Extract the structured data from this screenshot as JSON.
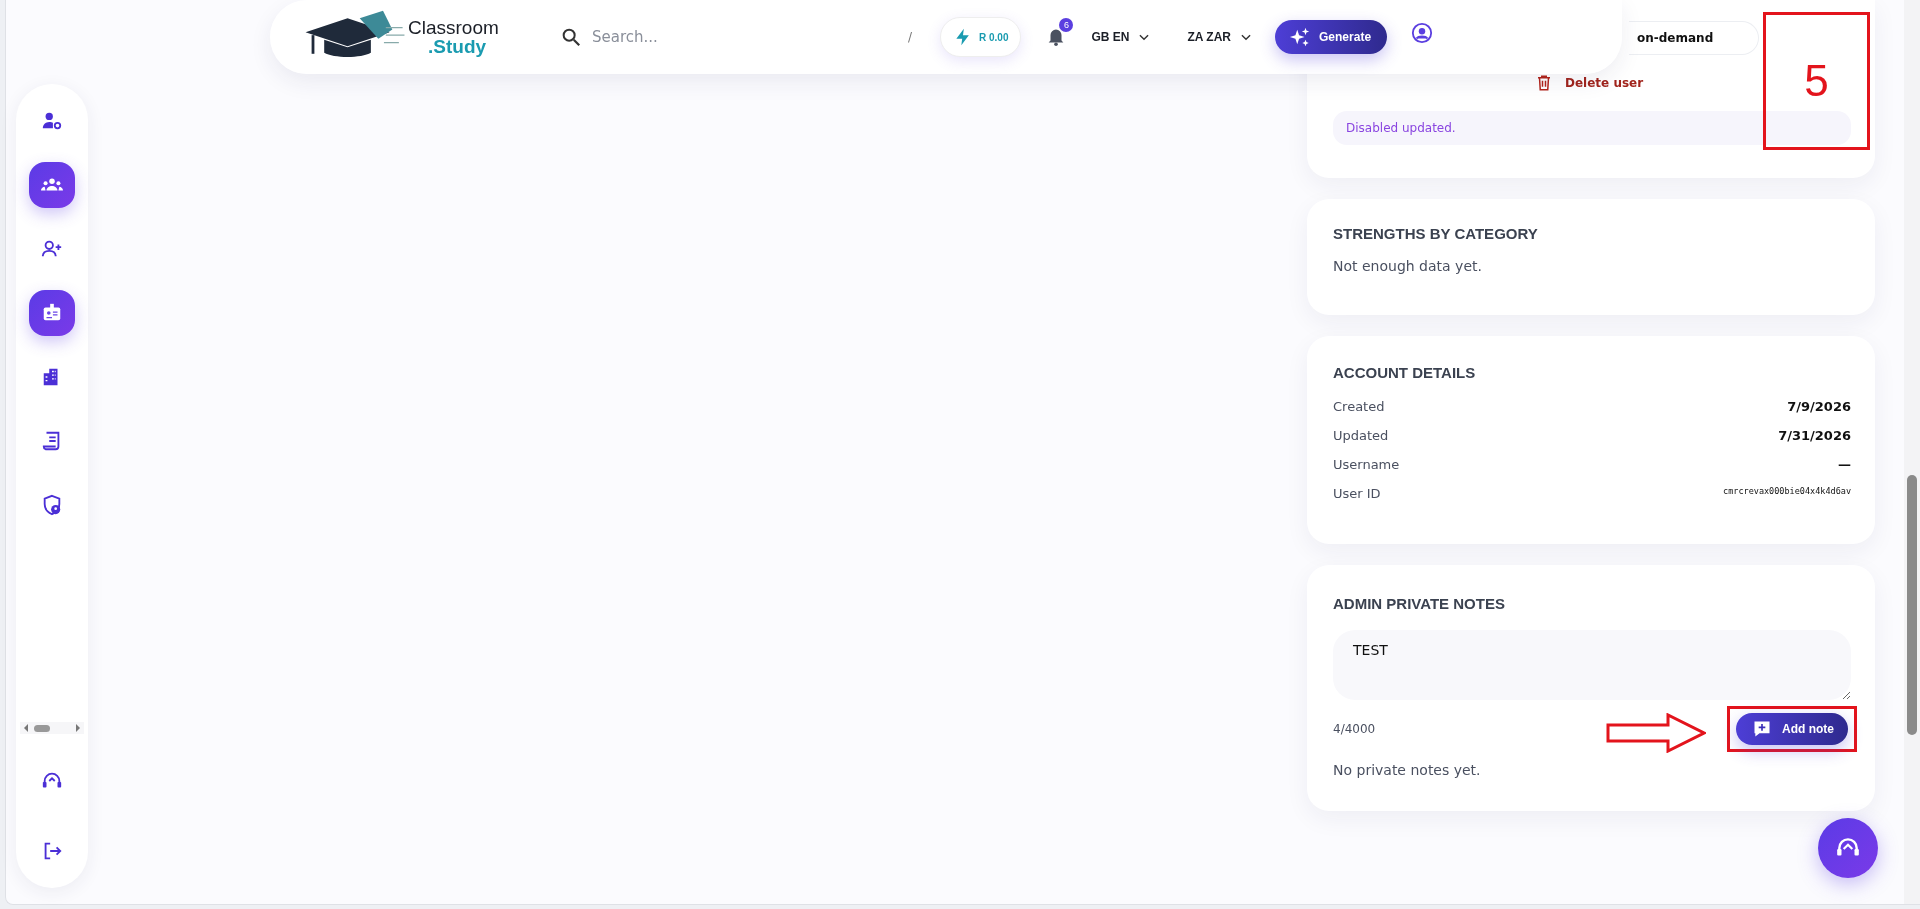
{
  "header": {
    "logo": {
      "line_1": "Classroom",
      "line_2": ".Study"
    },
    "search": {
      "placeholder": "Search...",
      "shortcut": "/"
    },
    "balance": "R 0.00",
    "notifications": {
      "count": "6"
    },
    "language": "GB EN",
    "currency": "ZA ZAR",
    "generate_button": "Generate"
  },
  "sidebar": {
    "items": [
      {
        "kind": "user-settings",
        "selected": false
      },
      {
        "kind": "group",
        "selected": true
      },
      {
        "kind": "user-add",
        "selected": false
      },
      {
        "kind": "id-badge",
        "selected": true
      },
      {
        "kind": "buildings",
        "selected": false
      },
      {
        "kind": "receipt",
        "selected": false
      },
      {
        "kind": "shield-user",
        "selected": false
      }
    ],
    "bottom_items": [
      {
        "kind": "headset",
        "selected": false
      },
      {
        "kind": "logout",
        "selected": false
      }
    ]
  },
  "user_card": {
    "field_text": "on-demand",
    "delete_label": "Delete user",
    "status_message": "Disabled updated."
  },
  "strengths": {
    "title": "STRENGTHS BY CATEGORY",
    "empty_text": "Not enough data yet."
  },
  "account_details": {
    "title": "ACCOUNT DETAILS",
    "rows": [
      {
        "label": "Created",
        "value": "7/9/2026",
        "kind": "text"
      },
      {
        "label": "Updated",
        "value": "7/31/2026",
        "kind": "text"
      },
      {
        "label": "Username",
        "value": "—",
        "kind": "text"
      },
      {
        "label": "User ID",
        "value": "cmrcrevax000bie04x4k4d6av",
        "kind": "code"
      }
    ]
  },
  "notes": {
    "title": "ADMIN PRIVATE NOTES",
    "value": "TEST",
    "counter": "4/4000",
    "add_button": "Add note",
    "empty_text": "No private notes yet."
  },
  "annotation": {
    "label": "5"
  }
}
